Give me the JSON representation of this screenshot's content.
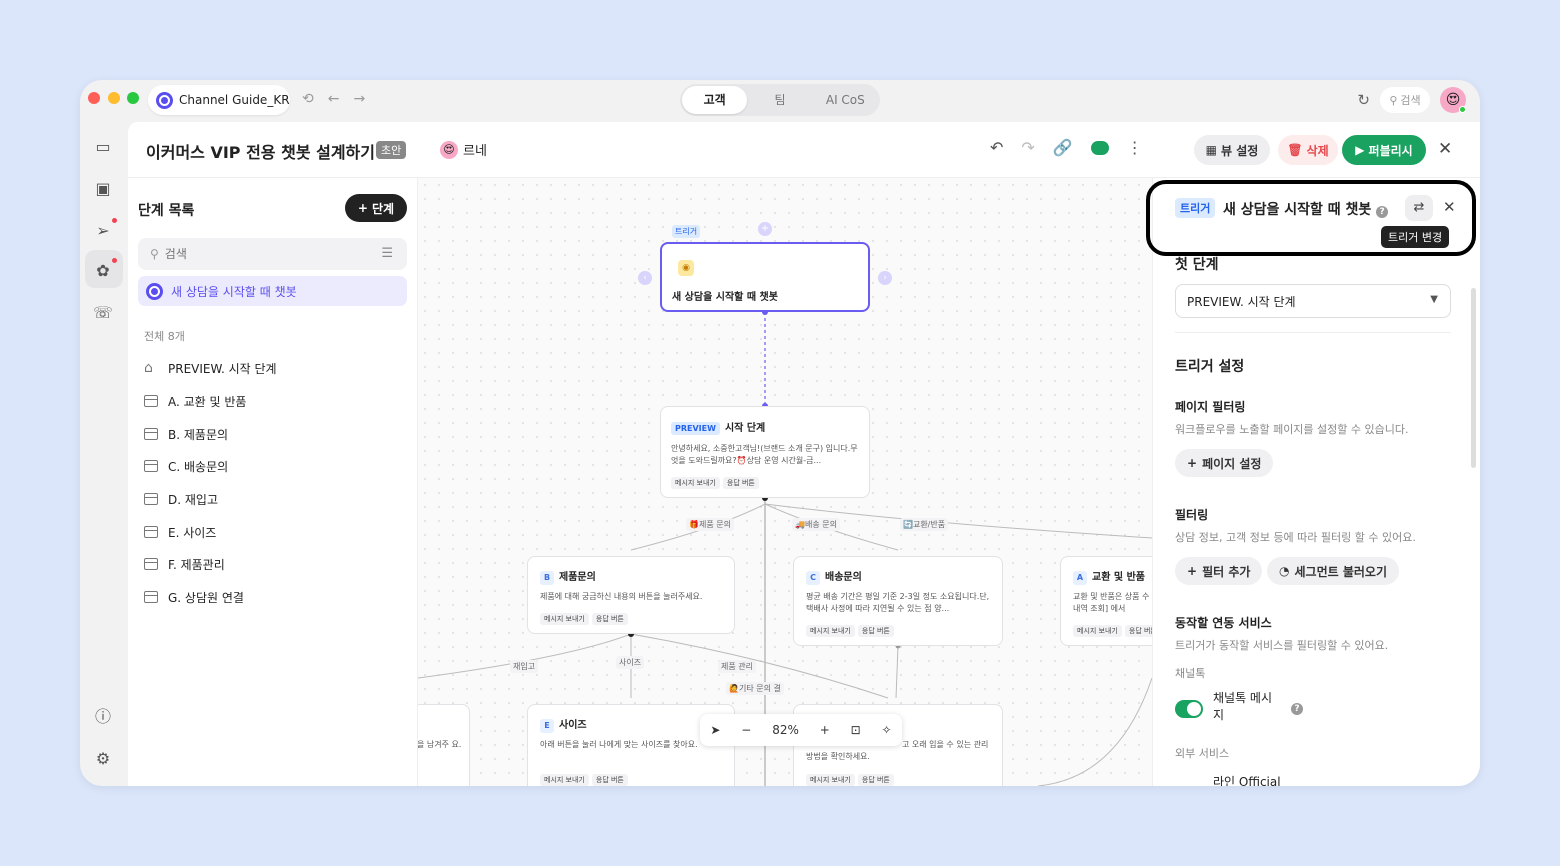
{
  "window": {
    "tab_title": "Channel Guide_KR",
    "segments": [
      "고객",
      "팀",
      "AI CoS"
    ],
    "search_label": "검색"
  },
  "header": {
    "title": "이커머스 VIP 전용 챗봇 설계하기",
    "draft_badge": "초안",
    "owner": "르네",
    "view_settings": "뷰 설정",
    "delete": "삭제",
    "publish": "퍼블리시"
  },
  "steps_panel": {
    "title": "단계 목록",
    "add_button": "단계",
    "search_placeholder": "검색",
    "trigger_item": "새 상담을 시작할 때 챗봇",
    "count_label": "전체 8개",
    "items": [
      "PREVIEW. 시작 단계",
      "A. 교환 및 반품",
      "B. 제품문의",
      "C. 배송문의",
      "D. 재입고",
      "E. 사이즈",
      "F. 제품관리",
      "G. 상담원 연결"
    ]
  },
  "canvas": {
    "trigger_tag": "트리거",
    "trigger_node_title": "새 상담을 시작할 때 챗봇",
    "preview_tag": "PREVIEW",
    "preview_title": "시작 단계",
    "preview_text": "안녕하세요, 소중한고객님!(브랜드 소개 문구) 입니다.무엇을 도와드릴까요?⏰상담 운영 시간월-금...",
    "chip_send": "메시지 보내기",
    "chip_reply": "응답 버튼",
    "edge_labels": [
      "🎁제품 문의",
      "🚚배송 문의",
      "🔄교환/반품",
      "재입고",
      "사이즈",
      "제품 관리",
      "🙋기타 문의 결"
    ],
    "node_b_letter": "B",
    "node_b_title": "제품문의",
    "node_b_text": "제품에 대해 궁금하신 내용의 버튼을 눌러주세요.",
    "node_c_letter": "C",
    "node_c_title": "배송문의",
    "node_c_text": "평균 배송 기간은 평일 기준 2-3일 정도 소요됩니다.단, 택배사 사정에 따라 지연될 수 있는 점 양...",
    "node_a_letter": "A",
    "node_a_title": "교환 및 반품",
    "node_a_text": "교환 및 반품은 상품 수 [주문내역 조회] 에서",
    "node_e_letter": "E",
    "node_e_title": "사이즈",
    "node_e_text": "아래 버튼을 눌러 나에게 맞는 사이즈를 찾아요.",
    "node_left_text": "을 남겨주 요.",
    "node_f_text": "고 오래 입을 수 있는 관리 방법을 확인하세요.",
    "zoom": "82%"
  },
  "right_panel": {
    "trigger_badge": "트리거",
    "trigger_name": "새 상담을 시작할 때 챗봇",
    "tooltip": "트리거 변경",
    "first_step_title": "첫 단계",
    "first_step_value": "PREVIEW. 시작 단계",
    "trigger_settings_title": "트리거 설정",
    "page_filter_title": "페이지 필터링",
    "page_filter_desc": "워크플로우를 노출할 페이지를 설정할 수 있습니다.",
    "page_settings_button": "페이지 설정",
    "filter_title": "필터링",
    "filter_desc": "상담 정보, 고객 정보 등에 따라 필터링 할 수 있어요.",
    "add_filter_button": "필터 추가",
    "load_segment_button": "세그먼트 불러오기",
    "service_title": "동작할 연동 서비스",
    "service_desc": "트리거가 동작할 서비스를 필터링할 수 있어요.",
    "channeltalk_label": "채널톡",
    "channeltalk_toggle": "채널톡 메시지",
    "external_label": "외부 서비스",
    "line_label": "라인 Official"
  }
}
